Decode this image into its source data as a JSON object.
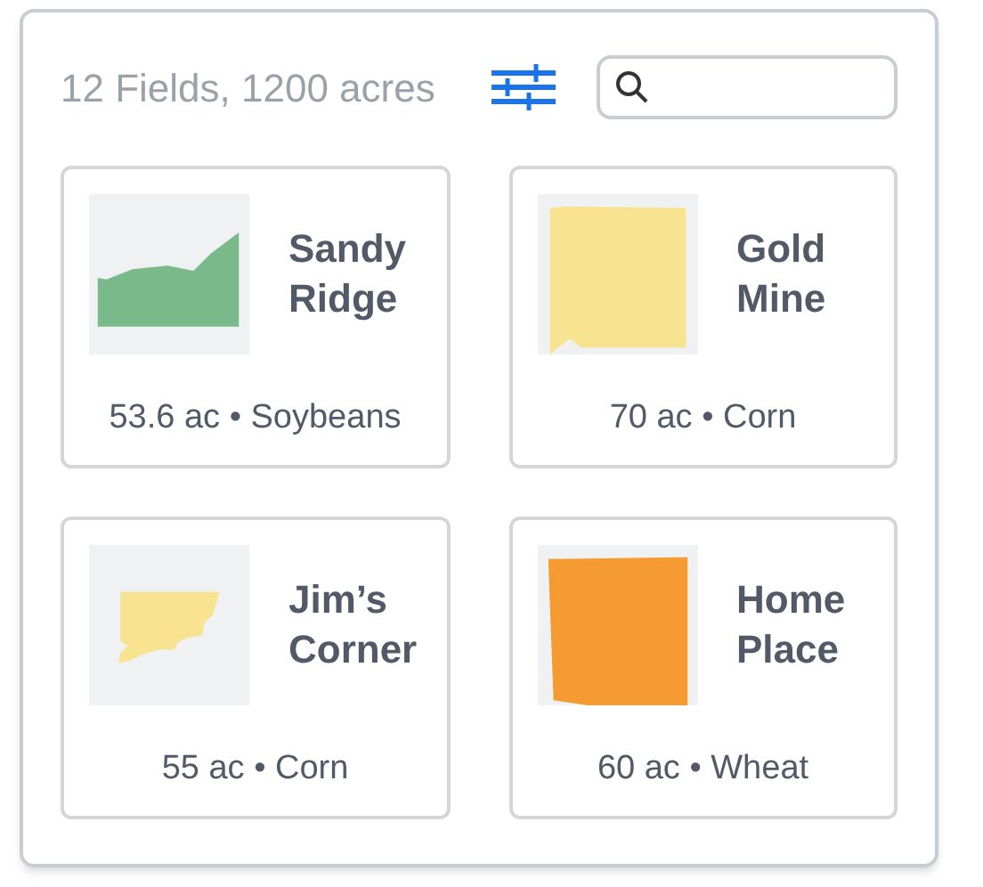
{
  "summary": "12 Fields, 1200 acres",
  "fields": [
    {
      "name": "Sandy Ridge",
      "details": "53.6 ac • Soybeans",
      "color": "#7aba8a",
      "kind": "ridge"
    },
    {
      "name": "Gold Mine",
      "details": "70 ac • Corn",
      "color": "#f8e390",
      "kind": "square"
    },
    {
      "name": "Jim’s Corner",
      "details": "55 ac • Corn",
      "color": "#f8e390",
      "kind": "corner"
    },
    {
      "name": "Home Place",
      "details": "60 ac • Wheat",
      "color": "#f59b32",
      "kind": "quad"
    }
  ]
}
